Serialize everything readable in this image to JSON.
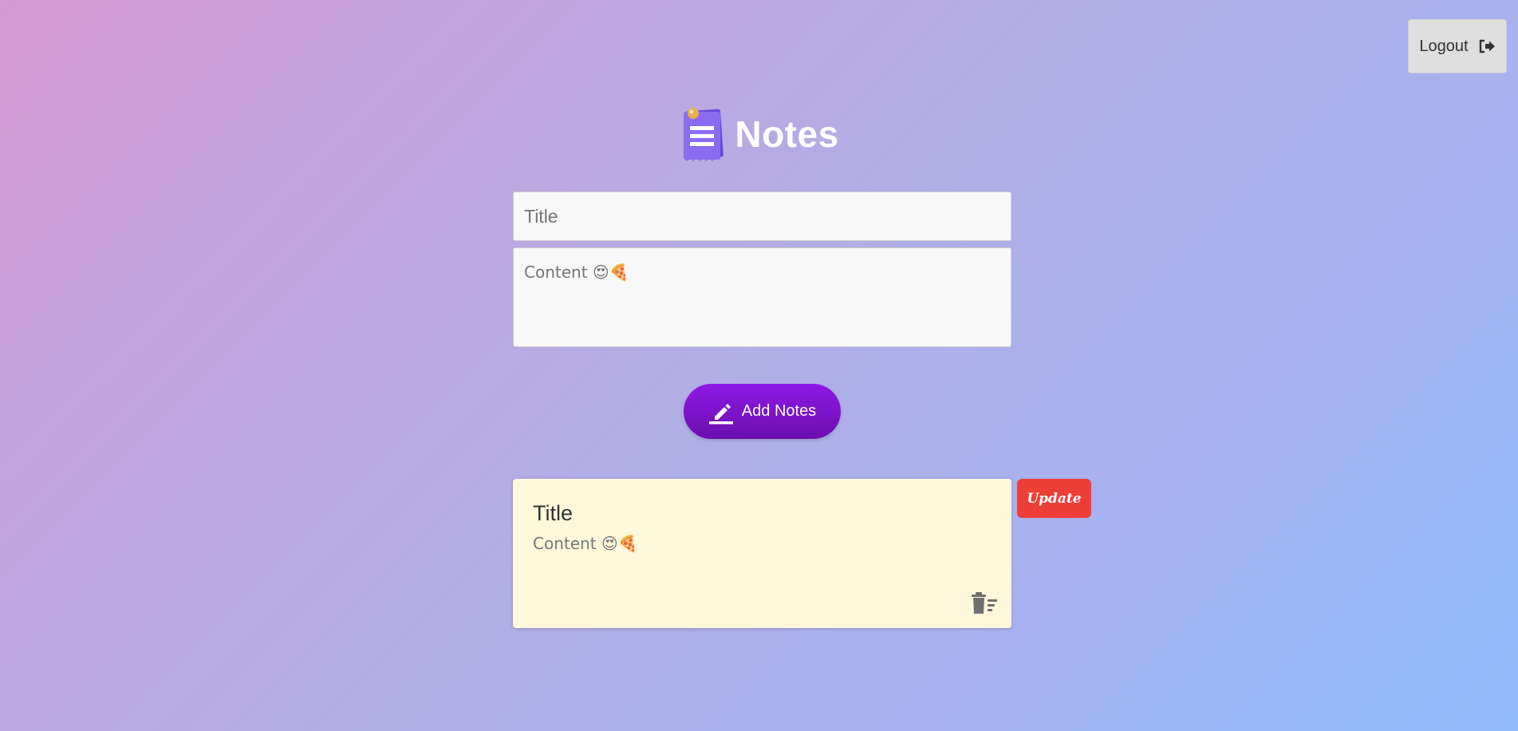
{
  "header": {
    "logout_label": "Logout",
    "logout_icon": "sign-out-icon",
    "app_title": "Notes",
    "logo_icon": "notepad-icon"
  },
  "form": {
    "title_placeholder": "Title",
    "content_placeholder": "Content 😍🍕",
    "add_button_label": "Add Notes",
    "add_button_icon": "pen-icon"
  },
  "notes": [
    {
      "title": "Title",
      "content": "Content 😍🍕",
      "update_label": "Update",
      "delete_icon": "trash-icon"
    }
  ],
  "colors": {
    "accent_purple": "#8f18e6",
    "update_red": "#ee3e38",
    "note_bg": "#fff8da"
  }
}
